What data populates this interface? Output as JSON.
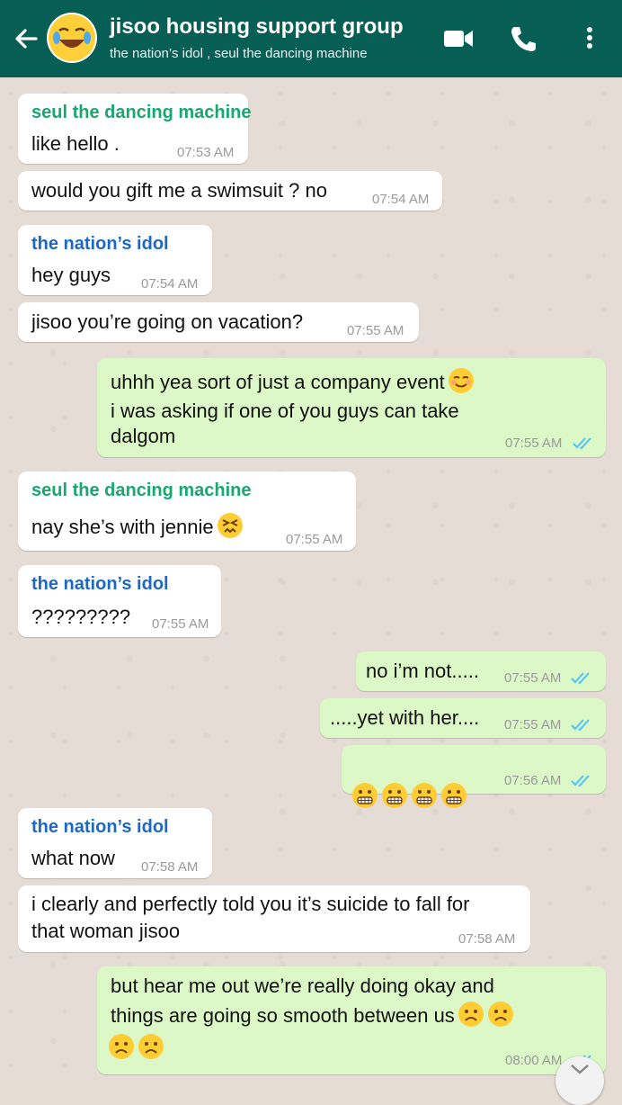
{
  "header": {
    "title": "jisoo housing support group",
    "subtitle": "the nation’s idol , seul the dancing machine",
    "icons": [
      "back-arrow-icon",
      "group-avatar",
      "video-call-icon",
      "phone-icon",
      "more-vert-icon"
    ]
  },
  "colors": {
    "header": "#075e54",
    "incoming": "#ffffff",
    "outgoing": "#dcf8c6",
    "sender_seul": "#19a66f",
    "sender_idol": "#1e68c5",
    "read_ticks": "#4fc3f7"
  },
  "messages": [
    {
      "direction": "in",
      "sender": "seul the dancing machine",
      "text": "like hello .",
      "time": "07:53 AM"
    },
    {
      "direction": "in",
      "text": "would you gift me a swimsuit ? no",
      "time": "07:54 AM"
    },
    {
      "direction": "in",
      "sender": "the nation’s idol",
      "text": "hey guys",
      "time": "07:54 AM"
    },
    {
      "direction": "in",
      "text": "jisoo you’re going on vacation?",
      "time": "07:55 AM"
    },
    {
      "direction": "out",
      "line1": "uhhh yea sort of just a company event",
      "line2": "i was asking if one of you guys can take",
      "line3": "dalgom",
      "emoji": "relieved-face",
      "time": "07:55 AM",
      "status": "read"
    },
    {
      "direction": "in",
      "sender": "seul the dancing machine",
      "text": "nay she’s with jennie",
      "emoji": "persevering-face",
      "time": "07:55 AM"
    },
    {
      "direction": "in",
      "sender": "the nation’s idol",
      "text": "?????????",
      "time": "07:55 AM"
    },
    {
      "direction": "out",
      "text": "no i’m not.....",
      "time": "07:55 AM",
      "status": "read"
    },
    {
      "direction": "out",
      "text": ".....yet with her....",
      "time": "07:55 AM",
      "status": "read"
    },
    {
      "direction": "out",
      "emoji": "grimacing-face x4",
      "time": "07:56 AM",
      "status": "read"
    },
    {
      "direction": "in",
      "sender": "the nation’s idol",
      "text": "what now",
      "time": "07:58 AM"
    },
    {
      "direction": "in",
      "text": "i clearly and perfectly told you it’s suicide to fall for\nthat woman jisoo",
      "time": "07:58 AM"
    },
    {
      "direction": "out",
      "line1": "but hear me out we’re really doing okay and",
      "line2": "things are going so smooth between us",
      "emoji": "frowning-face x4",
      "time": "08:00 AM",
      "status": "read"
    }
  ]
}
